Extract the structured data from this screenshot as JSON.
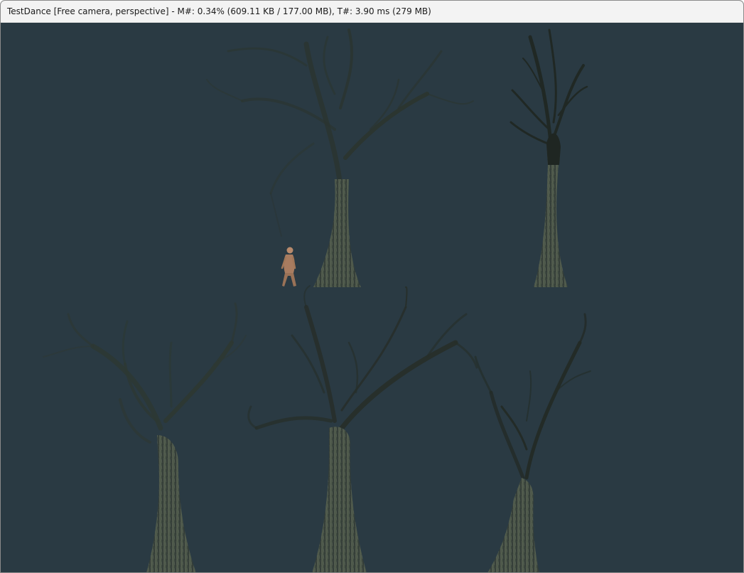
{
  "window": {
    "title": "TestDance [Free camera, perspective] - M#: 0.34% (609.11 KB / 177.00 MB), T#: 3.90 ms (279 MB)"
  },
  "scene": {
    "background_color": "#2a3a43",
    "trunk_color": "#3a4540",
    "trunk_highlight": "#5a6358",
    "branch_color": "#262f2b",
    "figure_color": "#b98a6a"
  }
}
